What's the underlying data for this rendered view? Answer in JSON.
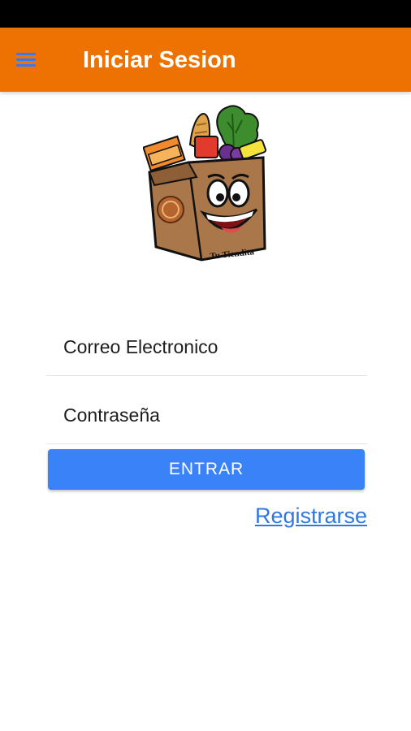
{
  "header": {
    "title": "Iniciar Sesion",
    "menu_icon": "hamburger-menu-icon"
  },
  "logo": {
    "text": "Tu Tiendita"
  },
  "form": {
    "email_placeholder": "Correo Electronico",
    "password_placeholder": "Contraseña",
    "submit_label": "ENTRAR",
    "register_label": "Registrarse"
  },
  "colors": {
    "app_bar": "#ED7202",
    "menu_icon": "#3A78F2",
    "primary_button": "#3A82F7",
    "link": "#2F78E0",
    "status_bar": "#000000"
  }
}
